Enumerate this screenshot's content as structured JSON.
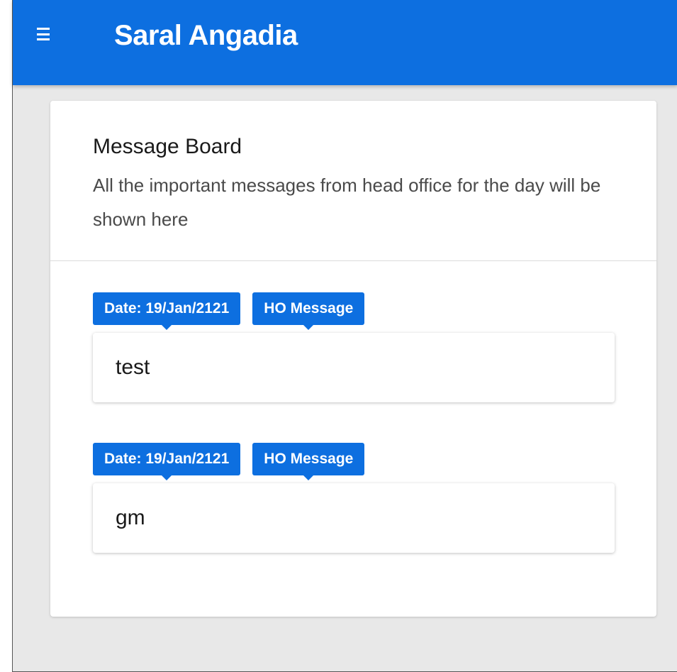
{
  "app": {
    "title": "Saral Angadia",
    "menu_icon": "hamburger-menu-icon",
    "accent_color": "#0d6fe0"
  },
  "board": {
    "title": "Message Board",
    "subtitle": "All the important messages from head office for the day will be shown here"
  },
  "messages": [
    {
      "date_tag": "Date: 19/Jan/2121",
      "type_tag": "HO Message",
      "text": "test"
    },
    {
      "date_tag": "Date: 19/Jan/2121",
      "type_tag": "HO Message",
      "text": "gm"
    }
  ]
}
